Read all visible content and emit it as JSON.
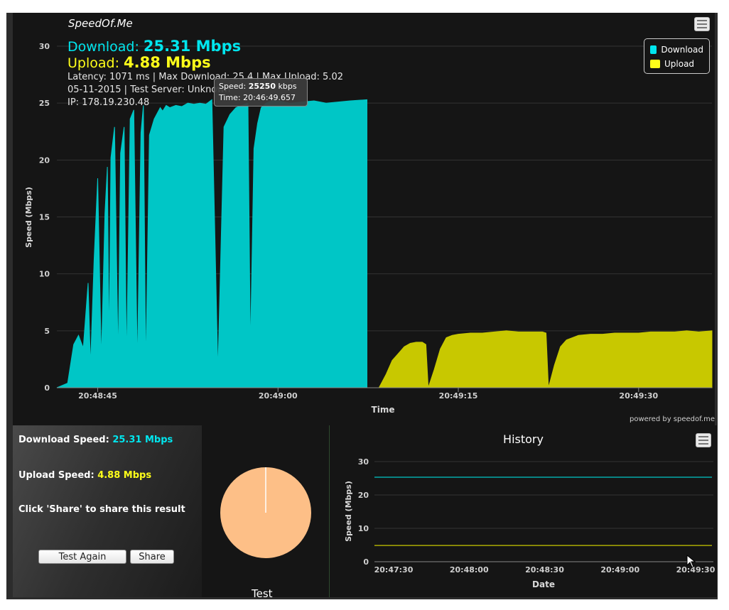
{
  "app": {
    "brand": "SpeedOf.Me"
  },
  "summary": {
    "download_label": "Download:",
    "download_value": "25.31 Mbps",
    "upload_label": "Upload:",
    "upload_value": "4.88 Mbps",
    "line1": "Latency: 1071 ms | Max Download: 25.4 | Max Upload: 5.02",
    "line2": "05-11-2015 | Test Server: Unknown",
    "line3": "IP: 178.19.230.48"
  },
  "legend": {
    "download": "Download",
    "upload": "Upload"
  },
  "tooltip": {
    "speed_label": "Speed:",
    "speed_value": "25250",
    "speed_unit": "kbps",
    "time_label": "Time:",
    "time_value": "20:46:49.657"
  },
  "powered_by": "powered by speedof.me",
  "colors": {
    "download": "#00c6c6",
    "upload": "#c8c800",
    "download_text": "#00e6ee",
    "upload_text": "#ffff1a",
    "pie": "#fdbf87",
    "panel": "#151515"
  },
  "icons": {
    "menu": "hamburger-menu-icon",
    "cursor": "mouse-pointer-icon"
  },
  "chart_data": [
    {
      "type": "area",
      "title": "",
      "xlabel": "Time",
      "ylabel": "Speed (Mbps)",
      "ylim": [
        0,
        30
      ],
      "yticks": [
        "0",
        "5",
        "10",
        "15",
        "20",
        "25",
        "30"
      ],
      "xticks": [
        "20:48:45",
        "20:49:00",
        "20:49:15",
        "20:49:30"
      ],
      "xtick_seconds": [
        45,
        60,
        75,
        90
      ],
      "xlim_seconds": [
        41.6,
        96.1
      ],
      "grid": true,
      "legend_position": "top-right",
      "series": [
        {
          "name": "Download",
          "x": [
            41.6,
            42.5,
            43.0,
            43.4,
            43.8,
            44.2,
            44.4,
            44.7,
            45.0,
            45.3,
            45.6,
            45.8,
            45.95,
            46.1,
            46.4,
            46.7,
            46.9,
            47.2,
            47.4,
            47.7,
            48.0,
            48.3,
            48.6,
            48.8,
            49.0,
            49.3,
            49.7,
            50.2,
            50.4,
            50.7,
            51.0,
            51.5,
            52.0,
            52.5,
            53.0,
            53.5,
            54.0,
            54.5,
            55.0,
            55.5,
            56.0,
            56.5,
            57.0,
            57.5,
            57.7,
            58.0,
            58.3,
            58.6,
            59.0,
            59.5,
            60.0,
            61.0,
            62.0,
            63.0,
            64.0,
            65.0,
            66.0,
            67.4,
            67.4
          ],
          "y": [
            0,
            0.4,
            3.8,
            4.6,
            3.5,
            9.2,
            1.9,
            11.2,
            18.4,
            2.4,
            15.3,
            19.4,
            3.5,
            20.2,
            22.9,
            2.4,
            20.6,
            22.9,
            2.0,
            23.6,
            24.4,
            1.8,
            22.4,
            24.8,
            1.5,
            22.2,
            23.6,
            24.6,
            24.3,
            24.8,
            24.6,
            24.8,
            24.7,
            25.0,
            24.9,
            25.0,
            24.9,
            25.3,
            1.4,
            22.9,
            24.0,
            24.6,
            24.8,
            25.0,
            3.2,
            21.0,
            23.2,
            24.6,
            25.0,
            25.2,
            25.2,
            25.0,
            25.1,
            25.2,
            25.0,
            25.1,
            25.2,
            25.3,
            0
          ]
        },
        {
          "name": "Upload",
          "x": [
            67.4,
            68.4,
            69.0,
            69.5,
            70.0,
            70.5,
            71.0,
            71.5,
            72.0,
            72.3,
            72.5,
            72.5,
            73.0,
            73.5,
            74.0,
            74.5,
            75.0,
            76.0,
            77.0,
            78.0,
            79.0,
            80.0,
            81.0,
            82.0,
            82.3,
            82.5,
            82.5,
            83.0,
            83.5,
            84.0,
            85.0,
            86.0,
            87.0,
            88.0,
            89.0,
            90.0,
            91.0,
            92.0,
            93.0,
            94.0,
            95.0,
            96.1,
            96.1
          ],
          "y": [
            0,
            0,
            1.2,
            2.4,
            3.0,
            3.6,
            3.9,
            4.0,
            4.0,
            3.8,
            0,
            0,
            1.6,
            3.4,
            4.4,
            4.6,
            4.7,
            4.8,
            4.8,
            4.9,
            5.0,
            4.9,
            4.9,
            4.9,
            4.8,
            0,
            0,
            2.0,
            3.6,
            4.2,
            4.6,
            4.7,
            4.7,
            4.8,
            4.8,
            4.8,
            4.9,
            4.9,
            4.9,
            5.0,
            4.9,
            5.0,
            0
          ]
        }
      ]
    },
    {
      "type": "pie",
      "title": "Test",
      "values": [
        1
      ],
      "colors": [
        "#fdbf87"
      ]
    },
    {
      "type": "line",
      "title": "History",
      "xlabel": "Date",
      "ylabel": "Speed (Mbps)",
      "ylim": [
        0,
        30
      ],
      "yticks": [
        "0",
        "10",
        "20",
        "30"
      ],
      "xticks": [
        "20:47:30",
        "20:48:00",
        "20:48:30",
        "20:49:00",
        "20:49:30"
      ],
      "series": [
        {
          "name": "Download",
          "values": [
            25.31,
            25.31
          ]
        },
        {
          "name": "Upload",
          "values": [
            4.88,
            4.88
          ]
        }
      ]
    }
  ],
  "results": {
    "download_label": "Download Speed:",
    "download_value": "25.31 Mbps",
    "upload_label": "Upload Speed:",
    "upload_value": "4.88 Mbps",
    "share_hint": "Click 'Share' to share this result",
    "test_again": "Test Again",
    "share": "Share"
  },
  "pie_title": "Test",
  "history_title": "History"
}
